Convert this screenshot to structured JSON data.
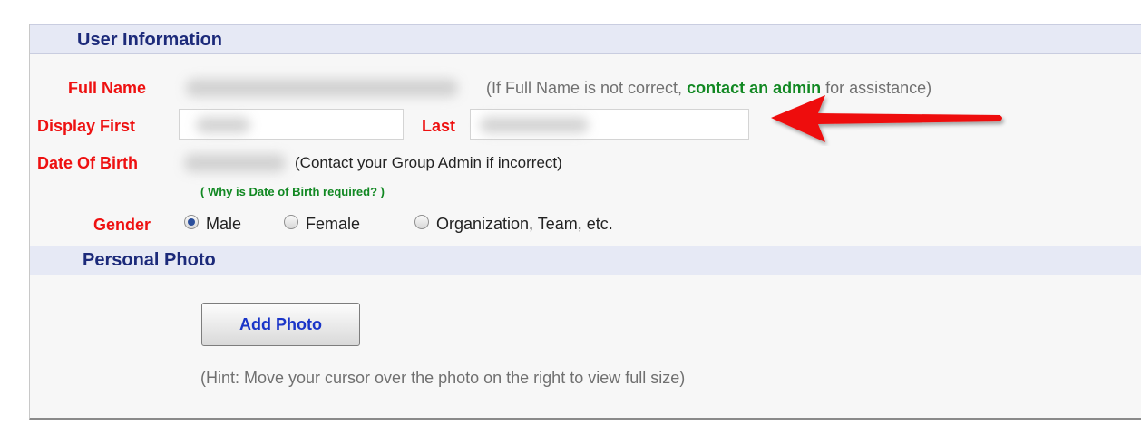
{
  "user_information": {
    "title": "User Information",
    "full_name": {
      "label": "Full Name",
      "note_prefix": "(If Full Name is not correct, ",
      "note_link": "contact an admin",
      "note_suffix": " for assistance)"
    },
    "display": {
      "first_label": "Display First",
      "last_label": "Last"
    },
    "dob": {
      "label": "Date Of Birth",
      "note": "(Contact your Group Admin if incorrect)",
      "why_link": "( Why is Date of Birth required? )"
    },
    "gender": {
      "label": "Gender",
      "selected": "Male",
      "options": [
        "Male",
        "Female",
        "Organization, Team, etc."
      ]
    }
  },
  "personal_photo": {
    "title": "Personal Photo",
    "add_button": "Add Photo",
    "hint": "(Hint: Move your cursor over the photo on the right to view full size)"
  },
  "colors": {
    "label_red": "#ee1111",
    "header_blue": "#1c2a7a",
    "link_green": "#118822",
    "annotation_arrow": "#ee1111"
  }
}
